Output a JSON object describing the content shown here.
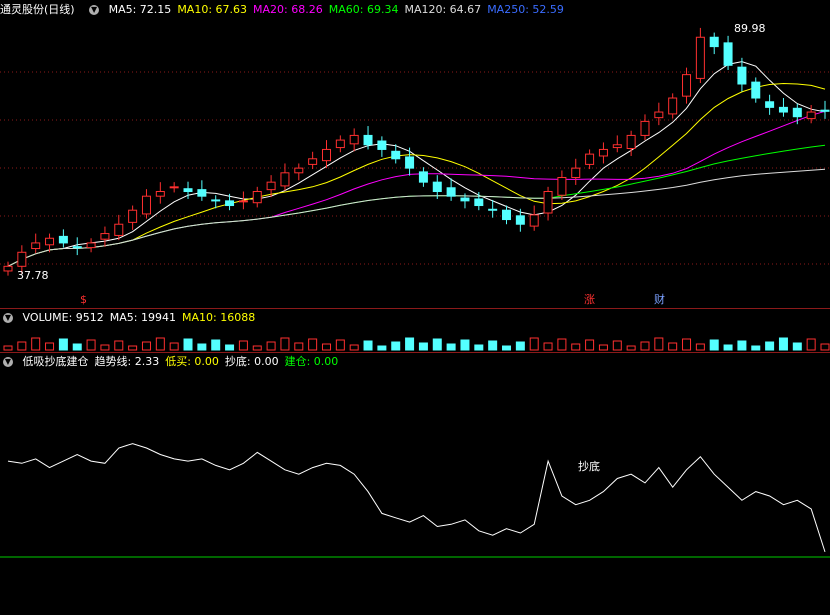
{
  "price_panel": {
    "stock_title": "通灵股份(日线)",
    "ma_items": [
      {
        "label": "MA5: 72.15",
        "color": "#ffffff"
      },
      {
        "label": "MA10: 67.63",
        "color": "#ffff00"
      },
      {
        "label": "MA20: 68.26",
        "color": "#ff00ff"
      },
      {
        "label": "MA60: 69.34",
        "color": "#00ff00"
      },
      {
        "label": "MA120: 64.67",
        "color": "#dcdcdc"
      },
      {
        "label": "MA250: 52.59",
        "color": "#3a6cff"
      }
    ],
    "high_label": "89.98",
    "low_label": "37.78",
    "markers": [
      {
        "text": "$",
        "color": "#ff3030"
      },
      {
        "text": "涨",
        "color": "#ff3030"
      },
      {
        "text": "财",
        "color": "#7aa0ff"
      }
    ]
  },
  "volume_panel": {
    "items": [
      {
        "label": "VOLUME: 9512",
        "color": "#ffffff"
      },
      {
        "label": "MA5: 19941",
        "color": "#ffffff"
      },
      {
        "label": "MA10: 16088",
        "color": "#ffff00"
      }
    ]
  },
  "indicator_panel": {
    "items": [
      {
        "label": "低吸抄底建仓",
        "color": "#ffffff"
      },
      {
        "label": "趋势线: 2.33",
        "color": "#ffffff"
      },
      {
        "label": "低买: 0.00",
        "color": "#ffff00"
      },
      {
        "label": "抄底: 0.00",
        "color": "#ffffff"
      },
      {
        "label": "建仓: 0.00",
        "color": "#00ff00"
      }
    ],
    "signal_label": "抄底"
  },
  "chart_data": {
    "type": "candlestick",
    "price_range": [
      37.78,
      89.98
    ],
    "closes": [
      39,
      42,
      44,
      45,
      44,
      43,
      44,
      46,
      48,
      51,
      54,
      55,
      56,
      55,
      54,
      53,
      52,
      53,
      55,
      57,
      59,
      60,
      62,
      64,
      66,
      67,
      65,
      64,
      62,
      60,
      57,
      55,
      54,
      53,
      52,
      51,
      49,
      48,
      50,
      55,
      58,
      60,
      63,
      64,
      65,
      67,
      70,
      72,
      75,
      80,
      88,
      86,
      82,
      78,
      75,
      73,
      72,
      71,
      72,
      72.15
    ],
    "trend_line": [
      44,
      43,
      45,
      41,
      44,
      47,
      44,
      43,
      50,
      52,
      50,
      47,
      45,
      44,
      45,
      42,
      40,
      43,
      48,
      44,
      40,
      38,
      41,
      43,
      42,
      38,
      30,
      20,
      18,
      16,
      19,
      14,
      15,
      17,
      12,
      10,
      13,
      11,
      15,
      44,
      28,
      24,
      26,
      30,
      36,
      38,
      34,
      41,
      32,
      40,
      46,
      38,
      32,
      26,
      30,
      28,
      24,
      26,
      22,
      2.33
    ],
    "baseline": 0.0
  }
}
